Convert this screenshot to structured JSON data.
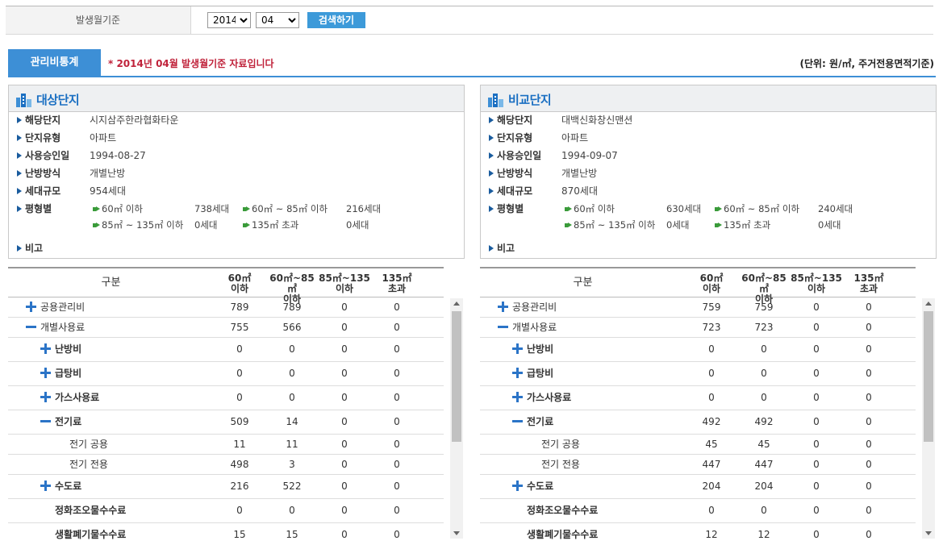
{
  "filter": {
    "label": "발생월기준",
    "year": "2014",
    "month": "04",
    "search_label": "검색하기"
  },
  "tab": {
    "label": "관리비통계",
    "notice": "* 2014년 04월 발생월기준 자료입니다",
    "unit": "(단위: 원/㎡, 주거전용면적기준)"
  },
  "colors": {
    "accent": "#3d8fd6",
    "notice": "#c0233b",
    "title": "#1a6fc2"
  },
  "target": {
    "title": "대상단지",
    "fields": [
      {
        "k": "해당단지",
        "v": "시지삼주한라협화타운"
      },
      {
        "k": "단지유형",
        "v": "아파트"
      },
      {
        "k": "사용승인일",
        "v": "1994-08-27"
      },
      {
        "k": "난방방식",
        "v": "개별난방"
      },
      {
        "k": "세대규모",
        "v": "954세대"
      }
    ],
    "size_label": "평형별",
    "sizes": [
      {
        "k": "60㎡ 이하",
        "v": "738세대"
      },
      {
        "k": "60㎡ ~ 85㎡ 이하",
        "v": "216세대"
      },
      {
        "k": "85㎡ ~ 135㎡ 이하",
        "v": "0세대"
      },
      {
        "k": "135㎡ 초과",
        "v": "0세대"
      }
    ],
    "note_label": "비고"
  },
  "compare": {
    "title": "비교단지",
    "fields": [
      {
        "k": "해당단지",
        "v": "대백신화창신맨션"
      },
      {
        "k": "단지유형",
        "v": "아파트"
      },
      {
        "k": "사용승인일",
        "v": "1994-09-07"
      },
      {
        "k": "난방방식",
        "v": "개별난방"
      },
      {
        "k": "세대규모",
        "v": "870세대"
      }
    ],
    "size_label": "평형별",
    "sizes": [
      {
        "k": "60㎡ 이하",
        "v": "630세대"
      },
      {
        "k": "60㎡ ~ 85㎡ 이하",
        "v": "240세대"
      },
      {
        "k": "85㎡ ~ 135㎡ 이하",
        "v": "0세대"
      },
      {
        "k": "135㎡ 초과",
        "v": "0세대"
      }
    ],
    "note_label": "비고"
  },
  "table_header": {
    "gubun": "구분",
    "c1a": "60㎡",
    "c1b": "이하",
    "c2a": "60㎡~85㎡",
    "c2b": "이하",
    "c3a": "85㎡~135",
    "c3b": "이하",
    "c4a": "135㎡",
    "c4b": "초과"
  },
  "target_table": [
    {
      "name": "공용관리비",
      "icon": "plus",
      "level": 1,
      "bold": false,
      "h": 25,
      "v": [
        "789",
        "789",
        "0",
        "0"
      ]
    },
    {
      "name": "개별사용료",
      "icon": "minus",
      "level": 1,
      "bold": false,
      "h": 25,
      "v": [
        "755",
        "566",
        "0",
        "0"
      ]
    },
    {
      "name": "난방비",
      "icon": "plus",
      "level": 2,
      "bold": true,
      "h": 30,
      "v": [
        "0",
        "0",
        "0",
        "0"
      ]
    },
    {
      "name": "급탕비",
      "icon": "plus",
      "level": 2,
      "bold": true,
      "h": 30,
      "v": [
        "0",
        "0",
        "0",
        "0"
      ]
    },
    {
      "name": "가스사용료",
      "icon": "plus",
      "level": 2,
      "bold": true,
      "h": 30,
      "v": [
        "0",
        "0",
        "0",
        "0"
      ]
    },
    {
      "name": "전기료",
      "icon": "minus",
      "level": 2,
      "bold": true,
      "h": 30,
      "v": [
        "509",
        "14",
        "0",
        "0"
      ]
    },
    {
      "name": "전기 공용",
      "icon": "",
      "level": 3,
      "bold": false,
      "h": 25,
      "v": [
        "11",
        "11",
        "0",
        "0"
      ]
    },
    {
      "name": "전기 전용",
      "icon": "",
      "level": 3,
      "bold": false,
      "h": 25,
      "v": [
        "498",
        "3",
        "0",
        "0"
      ]
    },
    {
      "name": "수도료",
      "icon": "plus",
      "level": 2,
      "bold": true,
      "h": 30,
      "v": [
        "216",
        "522",
        "0",
        "0"
      ]
    },
    {
      "name": "정화조오물수수료",
      "icon": "",
      "level": 4,
      "bold": true,
      "h": 30,
      "v": [
        "0",
        "0",
        "0",
        "0"
      ]
    },
    {
      "name": "생활폐기물수수료",
      "icon": "",
      "level": 4,
      "bold": true,
      "h": 30,
      "v": [
        "15",
        "15",
        "0",
        "0"
      ]
    }
  ],
  "compare_table": [
    {
      "name": "공용관리비",
      "icon": "plus",
      "level": 1,
      "bold": false,
      "h": 25,
      "v": [
        "759",
        "759",
        "0",
        "0"
      ]
    },
    {
      "name": "개별사용료",
      "icon": "minus",
      "level": 1,
      "bold": false,
      "h": 25,
      "v": [
        "723",
        "723",
        "0",
        "0"
      ]
    },
    {
      "name": "난방비",
      "icon": "plus",
      "level": 2,
      "bold": true,
      "h": 30,
      "v": [
        "0",
        "0",
        "0",
        "0"
      ]
    },
    {
      "name": "급탕비",
      "icon": "plus",
      "level": 2,
      "bold": true,
      "h": 30,
      "v": [
        "0",
        "0",
        "0",
        "0"
      ]
    },
    {
      "name": "가스사용료",
      "icon": "plus",
      "level": 2,
      "bold": true,
      "h": 30,
      "v": [
        "0",
        "0",
        "0",
        "0"
      ]
    },
    {
      "name": "전기료",
      "icon": "minus",
      "level": 2,
      "bold": true,
      "h": 30,
      "v": [
        "492",
        "492",
        "0",
        "0"
      ]
    },
    {
      "name": "전기 공용",
      "icon": "",
      "level": 3,
      "bold": false,
      "h": 25,
      "v": [
        "45",
        "45",
        "0",
        "0"
      ]
    },
    {
      "name": "전기 전용",
      "icon": "",
      "level": 3,
      "bold": false,
      "h": 25,
      "v": [
        "447",
        "447",
        "0",
        "0"
      ]
    },
    {
      "name": "수도료",
      "icon": "plus",
      "level": 2,
      "bold": true,
      "h": 30,
      "v": [
        "204",
        "204",
        "0",
        "0"
      ]
    },
    {
      "name": "정화조오물수수료",
      "icon": "",
      "level": 4,
      "bold": true,
      "h": 30,
      "v": [
        "0",
        "0",
        "0",
        "0"
      ]
    },
    {
      "name": "생활폐기물수수료",
      "icon": "",
      "level": 4,
      "bold": true,
      "h": 30,
      "v": [
        "12",
        "12",
        "0",
        "0"
      ]
    }
  ]
}
